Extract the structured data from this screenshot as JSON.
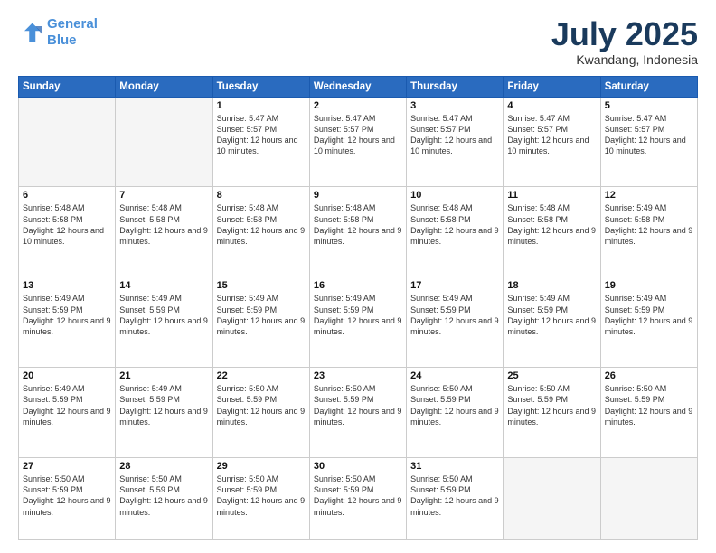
{
  "logo": {
    "line1": "General",
    "line2": "Blue"
  },
  "title": "July 2025",
  "location": "Kwandang, Indonesia",
  "days_of_week": [
    "Sunday",
    "Monday",
    "Tuesday",
    "Wednesday",
    "Thursday",
    "Friday",
    "Saturday"
  ],
  "weeks": [
    [
      {
        "day": "",
        "empty": true
      },
      {
        "day": "",
        "empty": true
      },
      {
        "day": "1",
        "sunrise": "5:47 AM",
        "sunset": "5:57 PM",
        "daylight": "12 hours and 10 minutes."
      },
      {
        "day": "2",
        "sunrise": "5:47 AM",
        "sunset": "5:57 PM",
        "daylight": "12 hours and 10 minutes."
      },
      {
        "day": "3",
        "sunrise": "5:47 AM",
        "sunset": "5:57 PM",
        "daylight": "12 hours and 10 minutes."
      },
      {
        "day": "4",
        "sunrise": "5:47 AM",
        "sunset": "5:57 PM",
        "daylight": "12 hours and 10 minutes."
      },
      {
        "day": "5",
        "sunrise": "5:47 AM",
        "sunset": "5:57 PM",
        "daylight": "12 hours and 10 minutes."
      }
    ],
    [
      {
        "day": "6",
        "sunrise": "5:48 AM",
        "sunset": "5:58 PM",
        "daylight": "12 hours and 10 minutes."
      },
      {
        "day": "7",
        "sunrise": "5:48 AM",
        "sunset": "5:58 PM",
        "daylight": "12 hours and 9 minutes."
      },
      {
        "day": "8",
        "sunrise": "5:48 AM",
        "sunset": "5:58 PM",
        "daylight": "12 hours and 9 minutes."
      },
      {
        "day": "9",
        "sunrise": "5:48 AM",
        "sunset": "5:58 PM",
        "daylight": "12 hours and 9 minutes."
      },
      {
        "day": "10",
        "sunrise": "5:48 AM",
        "sunset": "5:58 PM",
        "daylight": "12 hours and 9 minutes."
      },
      {
        "day": "11",
        "sunrise": "5:48 AM",
        "sunset": "5:58 PM",
        "daylight": "12 hours and 9 minutes."
      },
      {
        "day": "12",
        "sunrise": "5:49 AM",
        "sunset": "5:58 PM",
        "daylight": "12 hours and 9 minutes."
      }
    ],
    [
      {
        "day": "13",
        "sunrise": "5:49 AM",
        "sunset": "5:59 PM",
        "daylight": "12 hours and 9 minutes."
      },
      {
        "day": "14",
        "sunrise": "5:49 AM",
        "sunset": "5:59 PM",
        "daylight": "12 hours and 9 minutes."
      },
      {
        "day": "15",
        "sunrise": "5:49 AM",
        "sunset": "5:59 PM",
        "daylight": "12 hours and 9 minutes."
      },
      {
        "day": "16",
        "sunrise": "5:49 AM",
        "sunset": "5:59 PM",
        "daylight": "12 hours and 9 minutes."
      },
      {
        "day": "17",
        "sunrise": "5:49 AM",
        "sunset": "5:59 PM",
        "daylight": "12 hours and 9 minutes."
      },
      {
        "day": "18",
        "sunrise": "5:49 AM",
        "sunset": "5:59 PM",
        "daylight": "12 hours and 9 minutes."
      },
      {
        "day": "19",
        "sunrise": "5:49 AM",
        "sunset": "5:59 PM",
        "daylight": "12 hours and 9 minutes."
      }
    ],
    [
      {
        "day": "20",
        "sunrise": "5:49 AM",
        "sunset": "5:59 PM",
        "daylight": "12 hours and 9 minutes."
      },
      {
        "day": "21",
        "sunrise": "5:49 AM",
        "sunset": "5:59 PM",
        "daylight": "12 hours and 9 minutes."
      },
      {
        "day": "22",
        "sunrise": "5:50 AM",
        "sunset": "5:59 PM",
        "daylight": "12 hours and 9 minutes."
      },
      {
        "day": "23",
        "sunrise": "5:50 AM",
        "sunset": "5:59 PM",
        "daylight": "12 hours and 9 minutes."
      },
      {
        "day": "24",
        "sunrise": "5:50 AM",
        "sunset": "5:59 PM",
        "daylight": "12 hours and 9 minutes."
      },
      {
        "day": "25",
        "sunrise": "5:50 AM",
        "sunset": "5:59 PM",
        "daylight": "12 hours and 9 minutes."
      },
      {
        "day": "26",
        "sunrise": "5:50 AM",
        "sunset": "5:59 PM",
        "daylight": "12 hours and 9 minutes."
      }
    ],
    [
      {
        "day": "27",
        "sunrise": "5:50 AM",
        "sunset": "5:59 PM",
        "daylight": "12 hours and 9 minutes."
      },
      {
        "day": "28",
        "sunrise": "5:50 AM",
        "sunset": "5:59 PM",
        "daylight": "12 hours and 9 minutes."
      },
      {
        "day": "29",
        "sunrise": "5:50 AM",
        "sunset": "5:59 PM",
        "daylight": "12 hours and 9 minutes."
      },
      {
        "day": "30",
        "sunrise": "5:50 AM",
        "sunset": "5:59 PM",
        "daylight": "12 hours and 9 minutes."
      },
      {
        "day": "31",
        "sunrise": "5:50 AM",
        "sunset": "5:59 PM",
        "daylight": "12 hours and 9 minutes."
      },
      {
        "day": "",
        "empty": true
      },
      {
        "day": "",
        "empty": true
      }
    ]
  ]
}
